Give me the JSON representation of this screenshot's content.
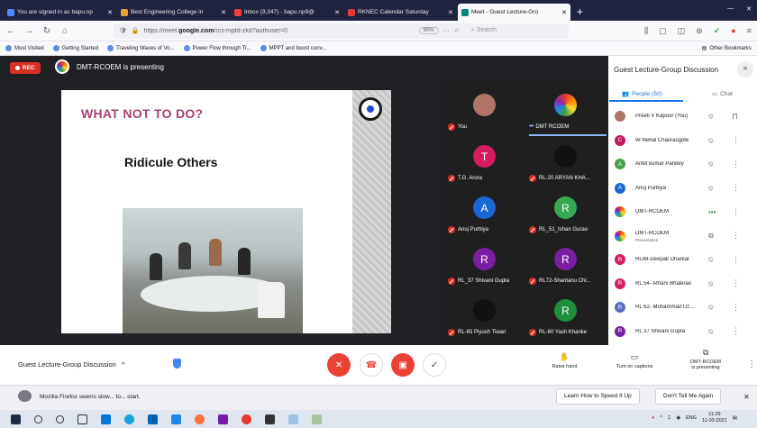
{
  "browser": {
    "tabs": [
      {
        "label": "You are signed in as bapu.np",
        "color": "#4a8cff",
        "active": false
      },
      {
        "label": "Best Engineering College in",
        "color": "#e9a33a",
        "active": false
      },
      {
        "label": "Inbox (9,347) - bapu.np9@",
        "color": "#ea4335",
        "active": false
      },
      {
        "label": "RKNEC Calendar Saturday",
        "color": "#e53935",
        "active": false
      },
      {
        "label": "Meet - Guest Lecture-Gro",
        "color": "#00897b",
        "active": true
      }
    ],
    "new_tab": "+",
    "url_prefix": "https://meet.",
    "url_domain": "google.com",
    "url_rest": "/rcs-mpfd-zkd?authuser=0",
    "zoom": "90%",
    "search_placeholder": "Search",
    "bookmarks": [
      "Most Visited",
      "Getting Started",
      "Traveling Waves of Vo...",
      "Power Flow through Tr...",
      "MPPT and boost conv..."
    ],
    "other_bookmarks": "Other Bookmarks"
  },
  "meet": {
    "rec_label": "REC",
    "presenting_text": "DMT-RCOEM is presenting",
    "slide": {
      "title": "WHAT NOT TO DO?",
      "heading": "Ridicule Others"
    },
    "tiles": [
      {
        "name": "You",
        "initial": "",
        "color": "#b0756a",
        "muted": true
      },
      {
        "name": "DMT RCOEM",
        "initial": "",
        "color": "#ffffff",
        "muted": false,
        "active": true
      },
      {
        "name": "T.G. Arora",
        "initial": "T",
        "color": "#d81b60",
        "muted": true
      },
      {
        "name": "RL-20 ARYAN KHA...",
        "initial": "",
        "color": "#111111",
        "muted": true
      },
      {
        "name": "Anuj Purbiya",
        "initial": "A",
        "color": "#1967d2",
        "muted": true
      },
      {
        "name": "RL_51_Ishan Gurao",
        "initial": "R",
        "color": "#34a853",
        "muted": true
      },
      {
        "name": "RL_37 Shivani Gupta",
        "initial": "R",
        "color": "#7b1fa2",
        "muted": true
      },
      {
        "name": "RL72-Shantanu Chi...",
        "initial": "R",
        "color": "#7b1fa2",
        "muted": true
      },
      {
        "name": "RL-65 Piyush Tiwari",
        "initial": "",
        "color": "#111111",
        "muted": true
      },
      {
        "name": "RL-60 Yash Khanke",
        "initial": "R",
        "color": "#1e8e3e",
        "muted": true
      }
    ]
  },
  "panel": {
    "title": "Guest Lecture-Group Discussion",
    "close": "×",
    "tab_people": "People (50)",
    "tab_chat": "Chat",
    "people": [
      {
        "name": "Preeti V Kapoor (You)",
        "initial": "",
        "color": "#b0756a",
        "sub": ""
      },
      {
        "name": "W-Nehal Chaurasgote",
        "initial": "C",
        "color": "#c2185b",
        "sub": ""
      },
      {
        "name": "Ankit kumar Pandey",
        "initial": "A",
        "color": "#43a047",
        "sub": ""
      },
      {
        "name": "Anuj Purbiya",
        "initial": "A",
        "color": "#1967d2",
        "sub": ""
      },
      {
        "name": "DMT-RCOEM",
        "initial": "",
        "color": "#ffffff",
        "sub": ""
      },
      {
        "name": "DMT-RCOEM",
        "initial": "",
        "color": "#ffffff",
        "sub": "Presentation"
      },
      {
        "name": "RL48-Deepak Dharkar",
        "initial": "R",
        "color": "#d81b60",
        "sub": ""
      },
      {
        "name": "RL 54- Atharv Bhalerao",
        "initial": "R",
        "color": "#d81b60",
        "sub": ""
      },
      {
        "name": "RL 62- Mohammad Uz...",
        "initial": "R",
        "color": "#5c6bc0",
        "sub": ""
      },
      {
        "name": "RL 37 Shivani Gupta",
        "initial": "R",
        "color": "#7b1fa2",
        "sub": ""
      }
    ]
  },
  "controls": {
    "meeting_name": "Guest Lecture-Group Discussion",
    "raise_hand": "Raise hand",
    "captions": "Turn on captions",
    "presenting_line1": "DMT-RCOEM",
    "presenting_line2": "is presenting"
  },
  "notification": {
    "text": "Mozilla Firefox seems slow... to... start.",
    "learn": "Learn How to Speed It Up",
    "dont": "Don't Tell Me Again"
  },
  "taskbar": {
    "lang": "ENG",
    "time": "11:29",
    "date": "11-03-2021"
  }
}
